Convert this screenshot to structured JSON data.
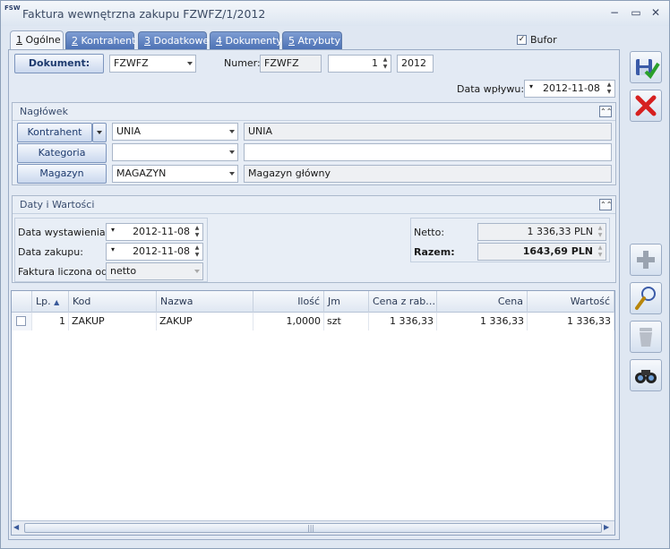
{
  "window": {
    "title": "Faktura wewnętrzna zakupu FZWFZ/1/2012",
    "app_icon": "FSW"
  },
  "tabs": [
    {
      "num": "1",
      "label": " Ogólne"
    },
    {
      "num": "2",
      "label": " Kontrahent"
    },
    {
      "num": "3",
      "label": " Dodatkowe"
    },
    {
      "num": "4",
      "label": " Dokumenty"
    },
    {
      "num": "5",
      "label": " Atrybuty"
    }
  ],
  "bufor": {
    "label": "Bufor",
    "checked": true
  },
  "document": {
    "button_label": "Dokument:",
    "type_value": "FZWFZ",
    "numer_label": "Numer:",
    "numer_prefix": "FZWFZ",
    "numer_value": "1",
    "numer_year": "2012",
    "data_wplywu_label": "Data wpływu:",
    "data_wplywu": "2012-11-08"
  },
  "naglowek": {
    "title": "Nagłówek",
    "kontrahent_label": "Kontrahent",
    "kontrahent_code": "UNIA",
    "kontrahent_name": "UNIA",
    "kategoria_label": "Kategoria",
    "kategoria_code": "",
    "kategoria_desc": "",
    "magazyn_label": "Magazyn",
    "magazyn_code": "MAGAZYN",
    "magazyn_name": "Magazyn główny"
  },
  "daty": {
    "title": "Daty i Wartości",
    "wystawienia_label": "Data wystawienia:",
    "wystawienia": "2012-11-08",
    "zakupu_label": "Data zakupu:",
    "zakupu": "2012-11-08",
    "liczona_label": "Faktura liczona od:",
    "liczona": "netto",
    "netto_label": "Netto:",
    "netto": "1 336,33 PLN",
    "razem_label": "Razem:",
    "razem": "1643,69 PLN"
  },
  "grid": {
    "columns": [
      "Lp.",
      "Kod",
      "Nazwa",
      "Ilość",
      "Jm",
      "Cena z rab…",
      "Cena",
      "Wartość"
    ],
    "rows": [
      {
        "lp": "1",
        "kod": "ZAKUP",
        "nazwa": "ZAKUP",
        "ilosc": "1,0000",
        "jm": "szt",
        "cena_rab": "1 336,33",
        "cena": "1 336,33",
        "wartosc": "1 336,33"
      }
    ]
  },
  "sidebar_icons": [
    "save-icon",
    "cancel-icon",
    "add-icon",
    "edit-icon",
    "delete-icon",
    "find-icon"
  ],
  "colors": {
    "tab_inactive": "#4d72b5",
    "accent": "#1d3a6e",
    "cancel": "#d62020",
    "save_check": "#2aa02a"
  }
}
